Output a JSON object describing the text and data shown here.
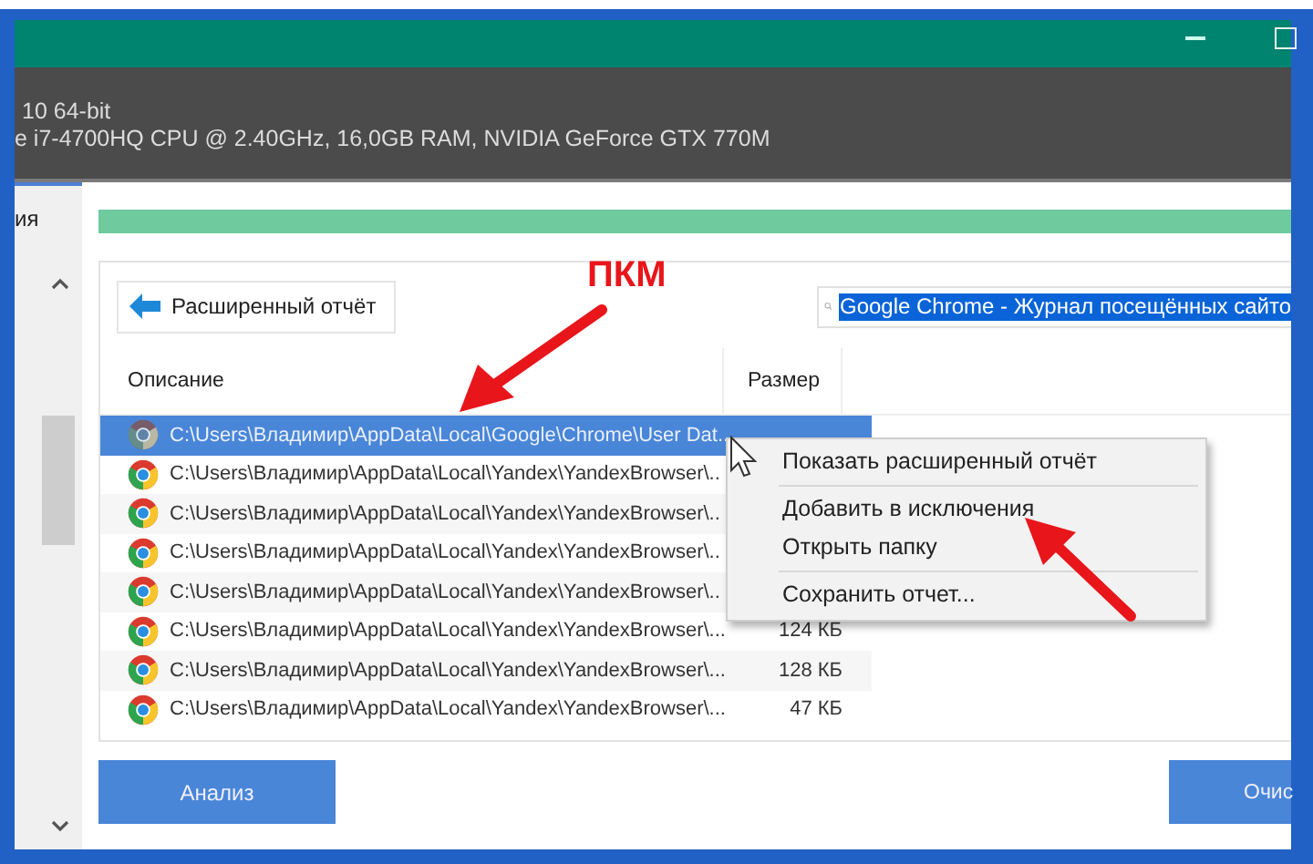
{
  "system_info": [
    "10 64-bit",
    "e i7-4700HQ CPU @ 2.40GHz, 16,0GB RAM, NVIDIA GeForce GTX 770M"
  ],
  "sidebar": {
    "label": "ия"
  },
  "progress": {
    "level": 1
  },
  "report_button": "Расширенный отчёт",
  "search": {
    "value": "Google Chrome - Журнал посещённых сайто"
  },
  "table": {
    "columns": [
      "Описание",
      "Размер"
    ],
    "rows": [
      {
        "description": "C:\\Users\\Владимир\\AppData\\Local\\Google\\Chrome\\User Dat..",
        "selected": true
      },
      {
        "description": "C:\\Users\\Владимир\\AppData\\Local\\Yandex\\YandexBrowser\\..",
        "selected": false
      },
      {
        "description": "C:\\Users\\Владимир\\AppData\\Local\\Yandex\\YandexBrowser\\..",
        "selected": false
      },
      {
        "description": "C:\\Users\\Владимир\\AppData\\Local\\Yandex\\YandexBrowser\\..",
        "selected": false
      },
      {
        "description": "C:\\Users\\Владимир\\AppData\\Local\\Yandex\\YandexBrowser\\..",
        "selected": false
      },
      {
        "description": "C:\\Users\\Владимир\\AppData\\Local\\Yandex\\YandexBrowser\\...",
        "size": "124 КБ",
        "selected": false
      },
      {
        "description": "C:\\Users\\Владимир\\AppData\\Local\\Yandex\\YandexBrowser\\...",
        "size": "128 КБ",
        "selected": false
      },
      {
        "description": "C:\\Users\\Владимир\\AppData\\Local\\Yandex\\YandexBrowser\\...",
        "size": "47 КБ",
        "selected": false
      }
    ]
  },
  "context_menu": [
    {
      "kind": "item",
      "label": "Показать расширенный отчёт"
    },
    {
      "kind": "separator"
    },
    {
      "kind": "item",
      "label": "Добавить в исключения"
    },
    {
      "kind": "item",
      "label": "Открыть папку"
    },
    {
      "kind": "separator"
    },
    {
      "kind": "item",
      "label": "Сохранить отчет..."
    }
  ],
  "buttons": [
    "Анализ",
    "Очис"
  ],
  "annotation": {
    "text": "ПКМ"
  }
}
